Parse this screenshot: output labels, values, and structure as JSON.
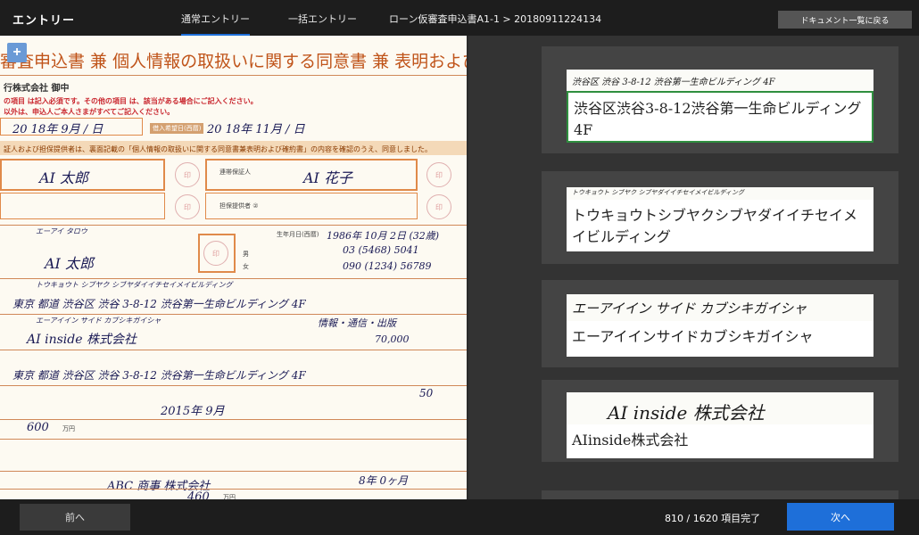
{
  "header": {
    "app_title": "エントリー",
    "tabs": [
      {
        "label": "通常エントリー",
        "active": true
      },
      {
        "label": "一括エントリー",
        "active": false
      }
    ],
    "breadcrumb": "ローン仮審査申込書A1-1 > 20180911224134",
    "back_label": "ドキュメント一覧に戻る"
  },
  "document": {
    "title": "審査申込書 兼 個人情報の取扱いに関する同意書 兼 表明および確約書",
    "bank": "行株式会社 御中",
    "notice_red": "の項目 は記入必須です。その他の項目 は、該当がある場合にご記入ください。",
    "notice_red2": "以外は、申込人ご本人さまがすべてご記入ください。",
    "date_handwriting": "20 18年 9月 / 日",
    "date2_label": "借入希望日(西暦)",
    "date2_handwriting": "20 18年 11月 / 日",
    "consent_text": "証人および担保提供者は、裏面記載の「個人情報の取扱いに関する同意書兼表明および確約書」の内容を確認のうえ、同意しました。",
    "applicant_name": "AI 太郎",
    "guarantor_label": "連帯保証人",
    "guarantor_name": "AI 花子",
    "collateral_label": "担保提供者 ②",
    "stamp": "印",
    "furigana_name": "エーアイ タロウ",
    "name_hand": "AI 太郎",
    "gender_male": "男",
    "gender_female": "女",
    "birth_label": "生年月日(西暦)",
    "birth_hand": "1986年 10月 2日 (32歳)",
    "tel_home_hand": "03 (5468) 5041",
    "tel_mobile_hand": "090 (1234) 56789",
    "address_kana_hand": "トウキョウト シブヤク シブヤダイイチセイメイビルディング",
    "address_hand": "東京 都道 渋谷区 渋谷 3-8-12 渋谷第一生命ビルディング 4F",
    "company_kana_hand": "エーアイイン サイド カブシキガイシャ",
    "company_hand": "AI inside 株式会社",
    "capital_hand": "70,000",
    "business_hand": "情報・通信・出版",
    "employees_hand": "50",
    "years_hand": "2015年 9月",
    "income_hand": "600",
    "income_unit": "万円",
    "prev_company_hand": "ABC 商事 株式会社",
    "prev_years_hand": "8年 0ヶ月",
    "deposit_hand": "460",
    "deposit_unit": "万円"
  },
  "entries": [
    {
      "crop_text": "渋谷区 渋谷 3-8-12 渋谷第一生命ビルディング 4F",
      "value": "渋谷区渋谷3-8-12渋谷第一生命ビルディング4F",
      "active": true
    },
    {
      "crop_text": "トウキョウト シブヤク シブヤダイイチセイメイビルディング",
      "value": "トウキョウトシブヤクシブヤダイイチセイメイビルディング",
      "active": false
    },
    {
      "crop_text": "エーアイイン サイド カブシキガイシャ",
      "value": "エーアイインサイドカブシキガイシャ",
      "active": false
    },
    {
      "crop_text": "AI inside 株式会社",
      "value": "AIinside株式会社",
      "active": false
    }
  ],
  "footer": {
    "prev_label": "前へ",
    "progress": "810 / 1620 項目完了",
    "next_label": "次へ"
  },
  "colors": {
    "accent": "#1e6fd9",
    "active_field_border": "#2f8f3f",
    "form_orange": "#e08a4a",
    "form_red": "#c9262e"
  }
}
